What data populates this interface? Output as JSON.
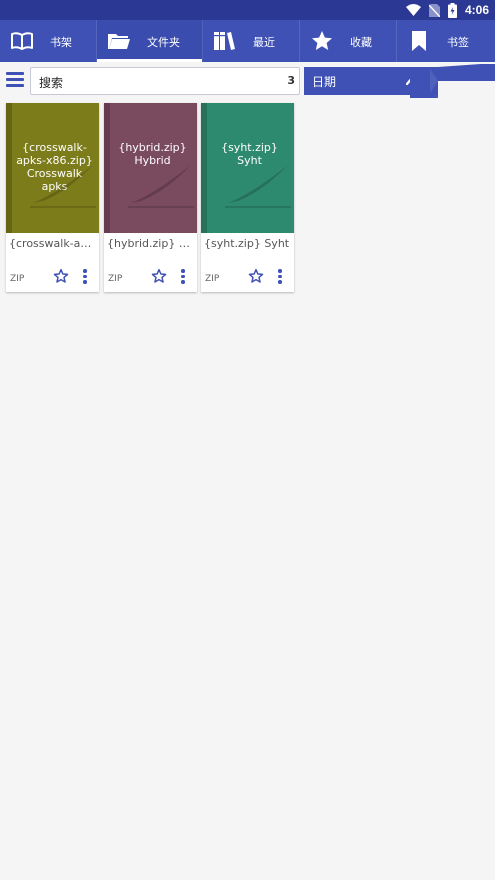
{
  "status_bar": {
    "time": "4:06"
  },
  "tabs": [
    {
      "label": "书架",
      "icon": "book-open-icon"
    },
    {
      "label": "文件夹",
      "icon": "folder-icon"
    },
    {
      "label": "最近",
      "icon": "books-stack-icon"
    },
    {
      "label": "收藏",
      "icon": "star-icon"
    },
    {
      "label": "书签",
      "icon": "bookmark-icon"
    }
  ],
  "active_tab": "文件夹",
  "toolbar": {
    "search_text": "搜索",
    "count": "3",
    "sort_label": "日期"
  },
  "books": [
    {
      "cover_title": "{crosswalk-apks-x86.zip} Crosswalk apks",
      "name": "{crosswalk-apks-x86.zip} Crosswalk apks",
      "format": "ZIP",
      "cover_color": "#7d7c1a"
    },
    {
      "cover_title": "{hybrid.zip} Hybrid",
      "name": "{hybrid.zip} Hybrid",
      "format": "ZIP",
      "cover_color": "#7a4a5e"
    },
    {
      "cover_title": "{syht.zip} Syht",
      "name": "{syht.zip} Syht",
      "format": "ZIP",
      "cover_color": "#2e8a6e"
    }
  ],
  "colors": {
    "primary": "#3f51b5",
    "status_bar": "#2b3894"
  }
}
